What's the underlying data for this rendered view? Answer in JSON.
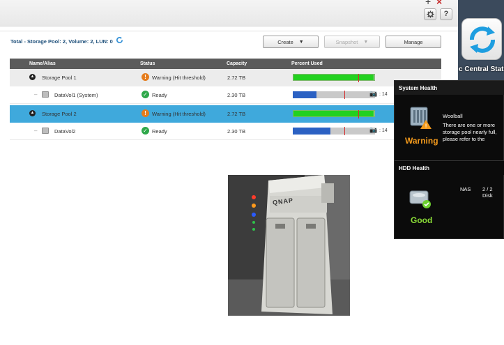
{
  "window": {
    "plus_glyph": "+",
    "close_glyph": "×"
  },
  "toolbar": {
    "gear_icon": "gear-icon",
    "help_label": "?"
  },
  "summary": {
    "text": "Total - Storage Pool: 2, Volume: 2, LUN: 0"
  },
  "buttons": {
    "create": "Create",
    "snapshot": "Snapshot",
    "manage": "Manage"
  },
  "table": {
    "headers": [
      "Name/Alias",
      "Status",
      "Capacity",
      "Percent Used"
    ],
    "rows": [
      {
        "name": "Storage Pool 1",
        "status": "Warning (Hit threshold)",
        "capacity": "2.72 TB",
        "used": 0.99,
        "threshold": 0.8,
        "kind": "pool"
      },
      {
        "name": "DataVol1 (System)",
        "status": "Ready",
        "capacity": "2.30 TB",
        "used": 0.29,
        "threshold": 0.63,
        "kind": "volume",
        "snapshots": ": 14"
      },
      {
        "name": "Storage Pool 2",
        "status": "Warning (Hit threshold)",
        "capacity": "2.72 TB",
        "used": 0.99,
        "threshold": 0.8,
        "kind": "pool",
        "selected": true
      },
      {
        "name": "DataVol2",
        "status": "Ready",
        "capacity": "2.30 TB",
        "used": 0.46,
        "threshold": 0.63,
        "kind": "volume",
        "snapshots": ": 14"
      }
    ]
  },
  "app": {
    "label": "c Central Stati"
  },
  "health": {
    "system_title": "System Health",
    "system_name": "Woolball",
    "system_message": "There are one or more storage pool nearly full, please refer to the",
    "system_status": "Warning",
    "hdd_title": "HDD Health",
    "hdd_nas": "NAS",
    "hdd_count": "2 / 2 Disk",
    "hdd_status": "Good"
  },
  "photo": {
    "brand": "QNAP"
  },
  "colors": {
    "warning": "#f39a1c",
    "good": "#8bdc37",
    "selected_row": "#3fa9dc",
    "bar_green": "#22d11f",
    "bar_blue": "#2b61c3"
  }
}
